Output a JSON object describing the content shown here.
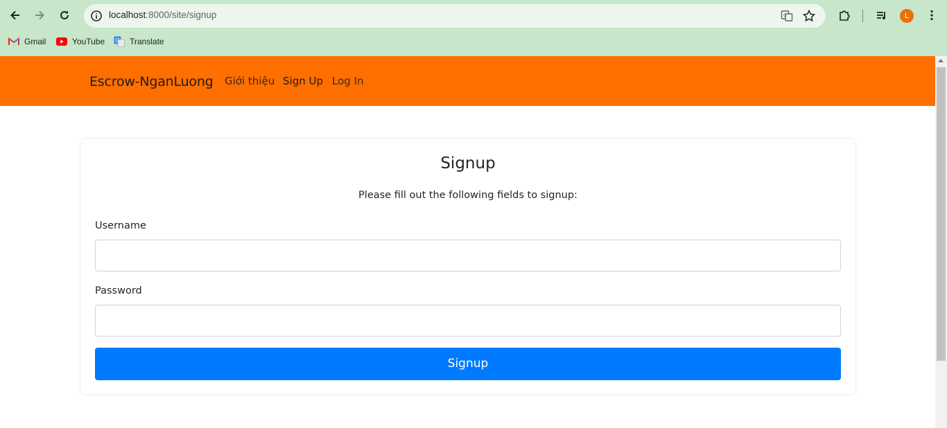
{
  "browser": {
    "url_host": "localhost",
    "url_rest": ":8000/site/signup",
    "profile_initial": "L",
    "bookmarks": [
      {
        "label": "Gmail",
        "icon": "gmail-icon"
      },
      {
        "label": "YouTube",
        "icon": "youtube-icon"
      },
      {
        "label": "Translate",
        "icon": "translate-icon"
      }
    ]
  },
  "navbar": {
    "brand": "Escrow-NganLuong",
    "links": [
      {
        "label": "Giới thiệu"
      },
      {
        "label": "Sign Up"
      },
      {
        "label": "Log In"
      }
    ]
  },
  "form": {
    "title": "Signup",
    "description": "Please fill out the following fields to signup:",
    "username_label": "Username",
    "username_value": "",
    "password_label": "Password",
    "password_value": "",
    "submit_label": "Signup"
  },
  "colors": {
    "chrome_bg": "#c8e6c9",
    "navbar_bg": "#ff6f00",
    "primary_button": "#007bff",
    "avatar": "#e8710a"
  }
}
